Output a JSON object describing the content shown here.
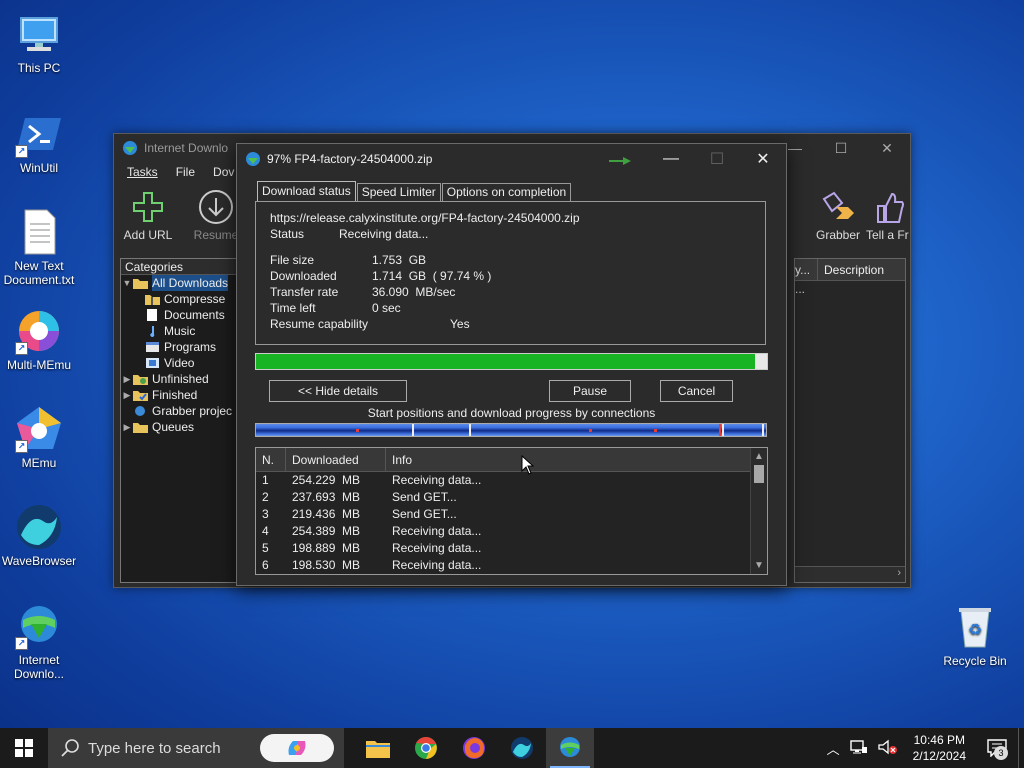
{
  "desktop": {
    "icons": [
      {
        "label": "This PC"
      },
      {
        "label": "WinUtil"
      },
      {
        "label": "New Text Document.txt"
      },
      {
        "label": "Multi-MEmu"
      },
      {
        "label": "MEmu"
      },
      {
        "label": "WaveBrowser"
      },
      {
        "label": "Internet Downlo..."
      },
      {
        "label": "Recycle Bin"
      }
    ]
  },
  "idm_main": {
    "title": "Internet Downlo",
    "menu": [
      "Tasks",
      "File",
      "Dov"
    ],
    "toolbar": {
      "add_url": "Add URL",
      "resume": "Resume",
      "grabber": "Grabber",
      "tell_friend": "Tell a Fr"
    },
    "categories_header": "Categories",
    "tree": [
      {
        "label": "All Downloads"
      },
      {
        "label": "Compresse"
      },
      {
        "label": "Documents"
      },
      {
        "label": "Music"
      },
      {
        "label": "Programs"
      },
      {
        "label": "Video"
      },
      {
        "label": "Unfinished"
      },
      {
        "label": "Finished"
      },
      {
        "label": "Grabber projec"
      },
      {
        "label": "Queues"
      }
    ],
    "list_cols": {
      "trunc": "y...",
      "description": "Description",
      "row1": "..."
    }
  },
  "dialog": {
    "title": "97% FP4-factory-24504000.zip",
    "tabs": [
      "Download status",
      "Speed Limiter",
      "Options on completion"
    ],
    "url": "https://release.calyxinstitute.org/FP4-factory-24504000.zip",
    "status_label": "Status",
    "status_value": "Receiving data...",
    "file_size_label": "File size",
    "file_size_value": "1.753  GB",
    "downloaded_label": "Downloaded",
    "downloaded_value": "1.714  GB  ( 97.74 % )",
    "transfer_rate_label": "Transfer rate",
    "transfer_rate_value": "36.090  MB/sec",
    "time_left_label": "Time left",
    "time_left_value": "0 sec",
    "resume_label": "Resume capability",
    "resume_value": "Yes",
    "progress_percent": 97.74,
    "buttons": {
      "hide_details": "<< Hide details",
      "pause": "Pause",
      "cancel": "Cancel"
    },
    "connections_caption": "Start positions and download progress by connections",
    "conn_headers": {
      "n": "N.",
      "downloaded": "Downloaded",
      "info": "Info"
    },
    "connections": [
      {
        "n": "1",
        "downloaded": "254.229  MB",
        "info": "Receiving data..."
      },
      {
        "n": "2",
        "downloaded": "237.693  MB",
        "info": "Send GET..."
      },
      {
        "n": "3",
        "downloaded": "219.436  MB",
        "info": "Send GET..."
      },
      {
        "n": "4",
        "downloaded": "254.389  MB",
        "info": "Receiving data..."
      },
      {
        "n": "5",
        "downloaded": "198.889  MB",
        "info": "Receiving data..."
      },
      {
        "n": "6",
        "downloaded": "198.530  MB",
        "info": "Receiving data..."
      }
    ]
  },
  "taskbar": {
    "search_placeholder": "Type here to search",
    "time": "10:46 PM",
    "date": "2/12/2024",
    "notification_count": "3"
  }
}
